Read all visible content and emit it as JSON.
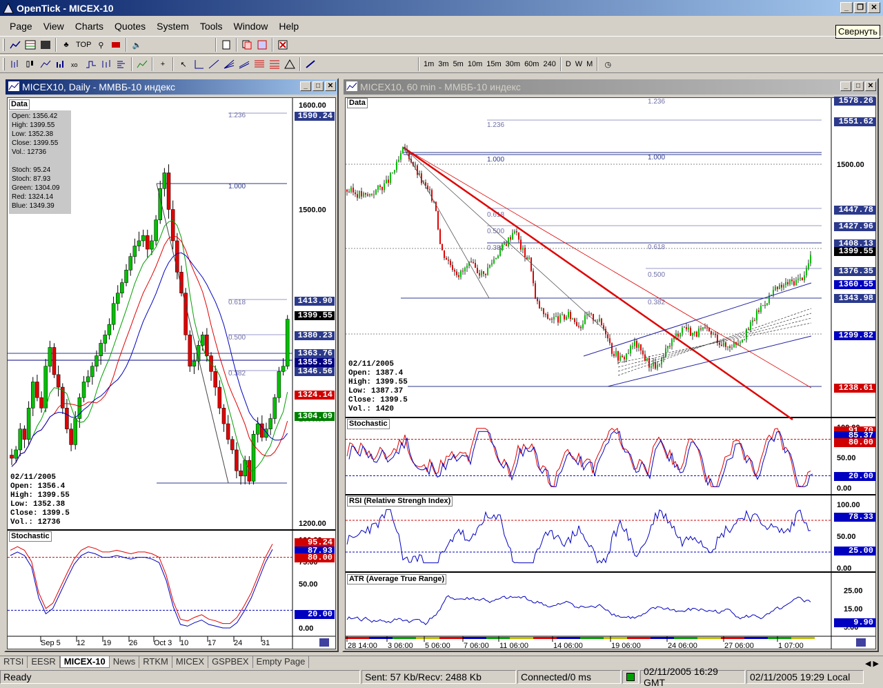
{
  "window": {
    "title": "OpenTick - MICEX-10",
    "tooltip": "Свернуть"
  },
  "menu": [
    "Page",
    "View",
    "Charts",
    "Quotes",
    "System",
    "Tools",
    "Window",
    "Help"
  ],
  "toolbar": {
    "top_label": "TOP",
    "intervals": [
      "1m",
      "3m",
      "5m",
      "10m",
      "15m",
      "30m",
      "60m",
      "240"
    ],
    "periods": [
      "D",
      "W",
      "M"
    ]
  },
  "left_chart": {
    "title": "MICEX10, Daily - ММВБ-10 индекс",
    "data_label": "Data",
    "databox": "Open: 1356.42\nHigh: 1399.55\nLow: 1352.38\nClose: 1399.55\nVol.: 12736\n\nStoch: 95.24\nStoch: 87.93\nGreen: 1304.09\nRed: 1324.14\nBlue: 1349.39",
    "info": "02/11/2005\nOpen: 1356.4\nHigh: 1399.55\nLow: 1352.38\nClose: 1399.5\nVol.: 12736",
    "price_axis": [
      "1600.00",
      "1500.00",
      "1300.00",
      "1200.00"
    ],
    "fib_labels": [
      "1.236",
      "1.000",
      "0.618",
      "0.500",
      "0.382"
    ],
    "tags": [
      {
        "v": "1590.24",
        "c": "#2c3a8c"
      },
      {
        "v": "1413.90",
        "c": "#2c3a8c"
      },
      {
        "v": "1399.55",
        "c": "#000"
      },
      {
        "v": "1380.23",
        "c": "#2c3a8c"
      },
      {
        "v": "1363.76",
        "c": "#2c3a8c"
      },
      {
        "v": "1355.35",
        "c": "#000080"
      },
      {
        "v": "1346.56",
        "c": "#2c3a8c"
      },
      {
        "v": "1324.14",
        "c": "#d00000"
      },
      {
        "v": "1304.09",
        "c": "#008000"
      }
    ],
    "stoch_label": "Stochastic",
    "stoch_axis": [
      "100.00",
      "75.00",
      "50.00",
      "0.00"
    ],
    "stoch_tags": [
      {
        "v": "95.24",
        "c": "#d00000"
      },
      {
        "v": "87.93",
        "c": "#0000c0"
      },
      {
        "v": "80.00",
        "c": "#d00000"
      },
      {
        "v": "20.00",
        "c": "#0000c0"
      }
    ],
    "x_labels": [
      "Sep 5",
      "12",
      "19",
      "26",
      "Oct 3",
      "10",
      "17",
      "24",
      "31"
    ]
  },
  "right_chart": {
    "title": "MICEX10, 60 min - ММВБ-10 индекс",
    "data_label": "Data",
    "info": "02/11/2005\nOpen: 1387.4\nHigh: 1399.55\nLow: 1387.37\nClose: 1399.5\nVol.: 1420",
    "price_axis": [
      "1500.00"
    ],
    "fib_labels": [
      "1.236",
      "1.236",
      "1.000",
      "1.000",
      "0.618",
      "0.500",
      "0.382",
      "0.618",
      "0.500",
      "0.382"
    ],
    "tags": [
      {
        "v": "1578.26",
        "c": "#2c3a8c"
      },
      {
        "v": "1551.62",
        "c": "#2c3a8c"
      },
      {
        "v": "1447.78",
        "c": "#2c3a8c"
      },
      {
        "v": "1427.96",
        "c": "#2c3a8c"
      },
      {
        "v": "1408.13",
        "c": "#2c3a8c"
      },
      {
        "v": "1399.55",
        "c": "#000"
      },
      {
        "v": "1376.35",
        "c": "#2c3a8c"
      },
      {
        "v": "1360.55",
        "c": "#0000c0"
      },
      {
        "v": "1343.98",
        "c": "#2c3a8c"
      },
      {
        "v": "1299.82",
        "c": "#0000c0"
      },
      {
        "v": "1238.61",
        "c": "#d00000"
      }
    ],
    "stoch_label": "Stochastic",
    "stoch_axis": [
      "100.00",
      "50.00",
      "0.00"
    ],
    "stoch_tags": [
      {
        "v": "91.70",
        "c": "#d00000"
      },
      {
        "v": "85.37",
        "c": "#0000c0"
      },
      {
        "v": "80.00",
        "c": "#d00000"
      },
      {
        "v": "20.00",
        "c": "#0000c0"
      }
    ],
    "rsi_label": "RSI (Relative Strengh Index)",
    "rsi_axis": [
      "100.00",
      "50.00",
      "0.00"
    ],
    "rsi_tags": [
      {
        "v": "78.33",
        "c": "#0000c0"
      },
      {
        "v": "25.00",
        "c": "#0000c0"
      }
    ],
    "atr_label": "ATR (Average True Range)",
    "atr_axis": [
      "25.00",
      "15.00",
      "5.00"
    ],
    "atr_tags": [
      {
        "v": "9.90",
        "c": "#0000c0"
      }
    ],
    "x_labels": [
      "28 14:00",
      "3 06:00",
      "5 06:00",
      "7 06:00",
      "11 06:00",
      "14 06:00",
      "19 06:00",
      "24 06:00",
      "27 06:00",
      "1 07:00"
    ]
  },
  "tabs": [
    "RTSI",
    "EESR",
    "MICEX-10",
    "News",
    "RTKM",
    "MICEX",
    "GSPBEX",
    "Empty Page"
  ],
  "active_tab": "MICEX-10",
  "status": {
    "ready": "Ready",
    "traffic": "Sent: 57 Kb/Recv: 2488 Kb",
    "connection": "Connected/0 ms",
    "gmt": "02/11/2005 16:29 GMT",
    "local": "02/11/2005 19:29 Local"
  }
}
